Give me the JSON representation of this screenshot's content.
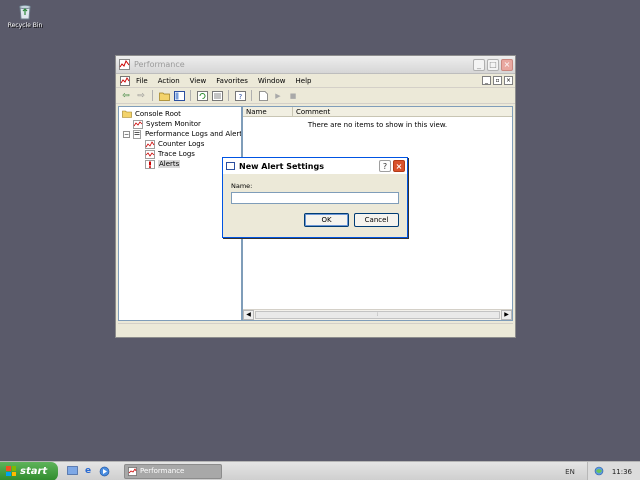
{
  "desktop": {
    "recycle_bin_label": "Recycle Bin"
  },
  "window": {
    "title": "Performance",
    "menu": [
      {
        "label": "File",
        "mnemonic": "F"
      },
      {
        "label": "Action",
        "mnemonic": "A"
      },
      {
        "label": "View",
        "mnemonic": "V"
      },
      {
        "label": "Favorites",
        "mnemonic": "o"
      },
      {
        "label": "Window",
        "mnemonic": "W"
      },
      {
        "label": "Help",
        "mnemonic": "H"
      }
    ],
    "tree": {
      "root": "Console Root",
      "system_monitor": "System Monitor",
      "perf_logs": "Performance Logs and Alerts",
      "counter_logs": "Counter Logs",
      "trace_logs": "Trace Logs",
      "alerts": "Alerts"
    },
    "list": {
      "columns": [
        "Name",
        "Comment"
      ],
      "empty_message": "There are no items to show in this view."
    }
  },
  "dialog": {
    "title": "New Alert Settings",
    "name_label": "Name:",
    "name_value": "",
    "ok_label": "OK",
    "cancel_label": "Cancel"
  },
  "taskbar": {
    "start_label": "start",
    "task_label": "Performance",
    "language": "EN",
    "clock": "11:36"
  },
  "colors": {
    "desktop": "#5a5a6a",
    "start_green": "#3f9d3b",
    "dialog_close": "#d9522c"
  }
}
